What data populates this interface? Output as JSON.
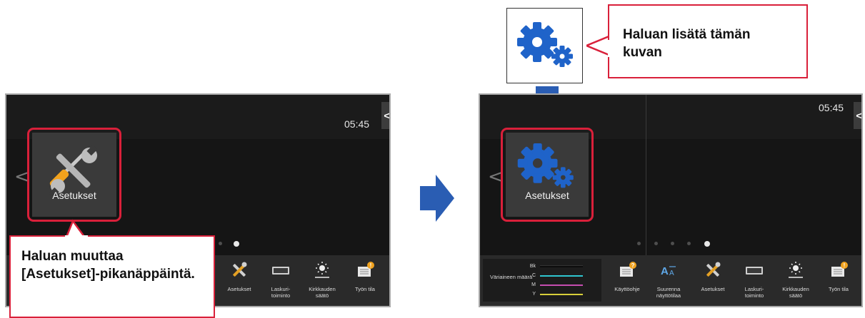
{
  "left_screen": {
    "clock": "05:45",
    "side_tab": "<",
    "nav_arrow": "<",
    "tile_label": "Asetukset",
    "page_dots": 2,
    "active_dot": 1,
    "quick_bar": [
      {
        "label": "Asetukset",
        "icon": "wrench-screwdriver-icon"
      },
      {
        "label": "Laskuri-\ntoiminto",
        "icon": "counter-icon"
      },
      {
        "label": "Kirkkauden\nsäätö",
        "icon": "brightness-icon"
      },
      {
        "label": "Työn tila",
        "icon": "job-status-icon"
      }
    ]
  },
  "left_callout": {
    "text_line1": "Haluan muuttaa",
    "text_line2": "[Asetukset]-pikanäppäintä."
  },
  "top_callout": {
    "text_line1": "Haluan lisätä tämän",
    "text_line2": "kuvan"
  },
  "right_screen": {
    "clock": "05:45",
    "side_tab": "<",
    "nav_arrow": "<",
    "tile_label": "Asetukset",
    "page_dots": 5,
    "active_dot": 4,
    "toner": {
      "label": "Väriaineen määrä",
      "rows": [
        {
          "key": "Bk",
          "color": "#111111"
        },
        {
          "key": "C",
          "color": "#2fc6d0"
        },
        {
          "key": "M",
          "color": "#c64db0"
        },
        {
          "key": "Y",
          "color": "#d7cf3a"
        }
      ]
    },
    "quick_bar": [
      {
        "label": "Käyttöohje",
        "icon": "manual-icon"
      },
      {
        "label": "Suurenna\nnäyttötilaa",
        "icon": "text-enlarge-icon"
      },
      {
        "label": "Asetukset",
        "icon": "wrench-screwdriver-icon"
      },
      {
        "label": "Laskuri-\ntoiminto",
        "icon": "counter-icon"
      },
      {
        "label": "Kirkkauden\nsäätö",
        "icon": "brightness-icon"
      },
      {
        "label": "Työn tila",
        "icon": "job-status-icon"
      }
    ]
  },
  "colors": {
    "accent_red": "#d9203a",
    "arrow_blue": "#2a5db3",
    "gear_blue": "#1f63c9"
  }
}
